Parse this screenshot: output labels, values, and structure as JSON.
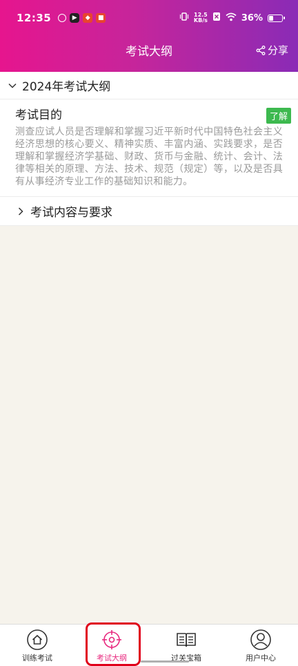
{
  "status": {
    "time": "12:35",
    "net_speed_value": "12.5",
    "net_speed_unit": "KB/s",
    "battery_pct": "36%",
    "battery_level": 0.36
  },
  "nav": {
    "title": "考试大纲",
    "share_label": "分享"
  },
  "outline": {
    "section_title": "2024年考试大纲",
    "items": [
      {
        "title": "考试目的",
        "tag": "了解",
        "description": "测查应试人员是否理解和掌握习近平新时代中国特色社会主义经济思想的核心要义、精神实质、丰富内涵、实践要求，是否理解和掌握经济学基础、财政、货币与金融、统计、会计、法律等相关的原理、方法、技术、规范（规定）等，以及是否具有从事经济专业工作的基础知识和能力。"
      }
    ],
    "collapsed_item": "考试内容与要求"
  },
  "tabs": [
    {
      "label": "训练考试",
      "icon": "home-icon",
      "active": false
    },
    {
      "label": "考试大纲",
      "icon": "target-icon",
      "active": true
    },
    {
      "label": "过关宝箱",
      "icon": "book-icon",
      "active": false
    },
    {
      "label": "用户中心",
      "icon": "user-icon",
      "active": false
    }
  ],
  "colors": {
    "header_gradient_start": "#e6158e",
    "header_gradient_end": "#8a2bb6",
    "tag_green": "#3db94f",
    "active_tab": "#e8287e",
    "highlight_red": "#e0001a"
  }
}
